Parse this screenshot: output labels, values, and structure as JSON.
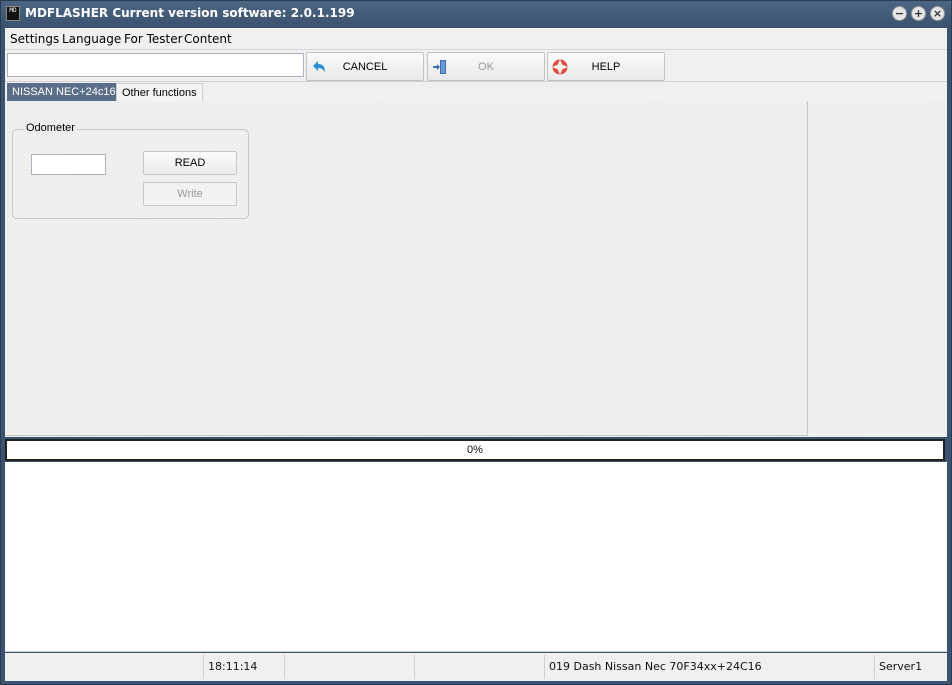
{
  "titlebar": {
    "app_icon_text": "MD",
    "title": "MDFLASHER  Current version software: 2.0.1.199",
    "minimize_glyph": "−",
    "maximize_glyph": "+",
    "close_glyph": "×"
  },
  "menu": {
    "items": [
      "Settings",
      "Language",
      "For Tester",
      "Content"
    ]
  },
  "toolbar": {
    "path_value": "",
    "cancel_label": "CANCEL",
    "ok_label": "OK",
    "help_label": "HELP",
    "icons": {
      "cancel": "undo-arrow-icon",
      "ok": "door-exit-icon",
      "help": "lifebuoy-icon"
    },
    "ok_enabled": false
  },
  "tabs": [
    {
      "label": "NISSAN NEC+24c16",
      "active": true
    },
    {
      "label": "Other functions",
      "active": false
    }
  ],
  "odometer": {
    "group_title": "Odometer",
    "value": "",
    "read_label": "READ",
    "write_label": "Write",
    "write_enabled": false
  },
  "progress": {
    "text": "0%",
    "fraction": 0
  },
  "statusbar": {
    "cells": [
      "",
      "18:11:14",
      "",
      "",
      "019 Dash Nissan Nec 70F34xx+24C16",
      "Server1"
    ]
  },
  "colors": {
    "titlebar": "#3b5370",
    "active_tab": "#5a6f87",
    "cancel_icon": "#2a8fd8",
    "help_icon": "#e04a3a"
  }
}
